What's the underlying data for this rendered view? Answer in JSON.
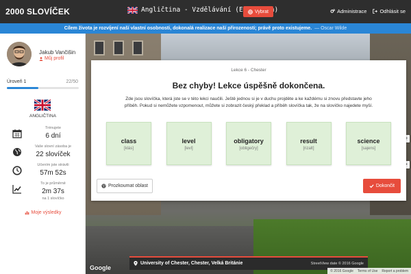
{
  "topbar": {
    "brand": "2000 SLOVÍČEK",
    "course": "Angličtina - Vzdělávání (Education)",
    "choose_button": "Vybrat",
    "admin_link": "Administrace",
    "logout_link": "Odhlásit se"
  },
  "quote": {
    "text": "Cílem života je rozvíjení naší vlastní osobnosti, dokonalá realizace naší přirozenosti; právě proto existujeme.",
    "author": "— Oscar Wilde"
  },
  "sidebar": {
    "user_name": "Jakub Vančišin",
    "profile_link": "Můj profil",
    "level_label": "Úroveň 1",
    "level_count": "22/50",
    "level_progress": 0.44,
    "language": "ANGLIČTINA",
    "stats": [
      {
        "icon": "calendar-icon",
        "label": "Trénujete",
        "value": "6 dní",
        "sub": ""
      },
      {
        "icon": "globe-icon",
        "label": "Vaše slovní zásoba je",
        "value": "22 slovíček",
        "sub": ""
      },
      {
        "icon": "clock-icon",
        "label": "Učením jste strávili",
        "value": "57m 52s",
        "sub": ""
      },
      {
        "icon": "trend-icon",
        "label": "To je průměrně",
        "value": "2m 37s",
        "sub": "na 1 slovíčko"
      }
    ],
    "results_link": "Moje výsledky"
  },
  "modal": {
    "lesson": "Lekce 6 - Chester",
    "title": "Bez chyby! Lekce úspěšně dokončena.",
    "description": "Zde jsou slovíčka, která jste se v této lekci naučili. Ještě jednou si je v duchu projděte a ke každému si znovu představte jeho příběh. Pokud si nemůžete vzpomenout, můžete si zobrazit český překlad a příběh slovíčka tak, že na slovíčko najedete myší.",
    "words": [
      {
        "word": "class",
        "ipa": "[klás]"
      },
      {
        "word": "level",
        "ipa": "[levl]"
      },
      {
        "word": "obligatory",
        "ipa": "[obligečry]"
      },
      {
        "word": "result",
        "ipa": "[rizalt]"
      },
      {
        "word": "science",
        "ipa": "[sajens]"
      }
    ],
    "explore_button": "Prozkoumat oblast",
    "finish_button": "Dokončit"
  },
  "streetview": {
    "google": "Google",
    "location": "University of Chester, Chester, Velká Británie",
    "date": "StreetView date © 2016 Google",
    "footer": [
      "© 2016 Google",
      "Terms of Use",
      "Report a problem"
    ]
  },
  "colors": {
    "accent": "#e74c3c",
    "primary": "#2a86d6",
    "topbar": "#2e2e2e",
    "card": "#dff0d8"
  }
}
